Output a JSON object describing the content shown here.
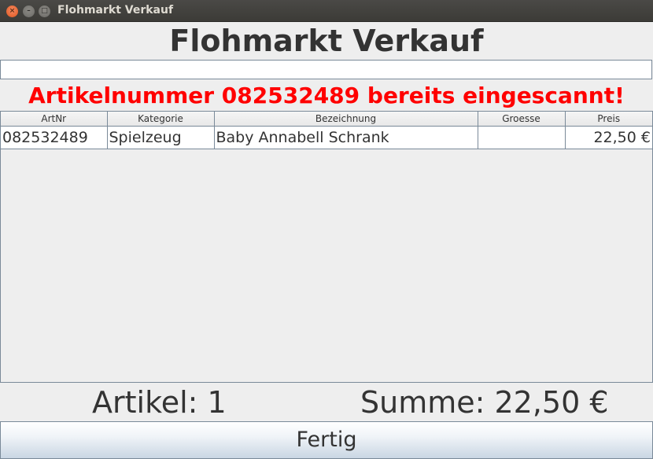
{
  "window": {
    "title": "Flohmarkt Verkauf",
    "close_glyph": "×",
    "minimize_glyph": "–",
    "maximize_glyph": "□"
  },
  "heading": "Flohmarkt Verkauf",
  "scan_input": {
    "value": "",
    "placeholder": ""
  },
  "message": {
    "text": "Artikelnummer 082532489 bereits eingescannt!",
    "color": "#ff0000"
  },
  "table": {
    "columns": [
      "ArtNr",
      "Kategorie",
      "Bezeichnung",
      "Groesse",
      "Preis"
    ],
    "rows": [
      [
        "082532489",
        "Spielzeug",
        "Baby Annabell Schrank",
        "",
        "22,50 €"
      ]
    ]
  },
  "summary": {
    "artikel": "Artikel: 1",
    "summe": "Summe: 22,50 €"
  },
  "buttons": {
    "fertig": "Fertig"
  }
}
